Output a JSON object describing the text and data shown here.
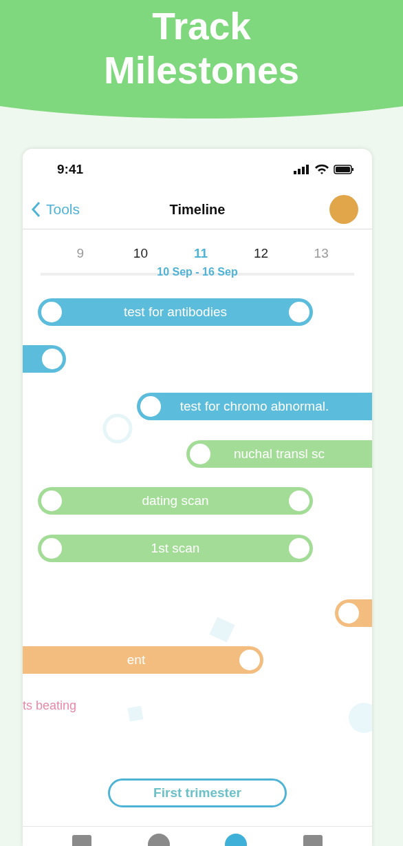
{
  "banner": {
    "title": "Track Milestones"
  },
  "status_bar": {
    "time": "9:41"
  },
  "nav": {
    "back": "Tools",
    "title": "Timeline"
  },
  "days": [
    {
      "label": "9",
      "selected": false,
      "emphasis": false
    },
    {
      "label": "10",
      "selected": false,
      "emphasis": true
    },
    {
      "label": "11",
      "selected": true,
      "emphasis": true
    },
    {
      "label": "12",
      "selected": false,
      "emphasis": true
    },
    {
      "label": "13",
      "selected": false,
      "emphasis": false
    }
  ],
  "week": "10 Sep - 16 Sep",
  "milestones": [
    {
      "kind": "bar",
      "label": "test for antibodies",
      "color": "#5bbcdb",
      "start_handle": true,
      "end_handle": true
    },
    {
      "kind": "bar",
      "color": "#5bbcdb",
      "start_handle": false,
      "end_handle": true
    },
    {
      "kind": "bar",
      "label": "test for chromo abnormal.",
      "color": "#5bbcdb",
      "start_handle": true,
      "end_handle": false
    },
    {
      "kind": "bar",
      "label": "nuchal transl sc",
      "color": "#a3dc96",
      "start_handle": true,
      "end_handle": false
    },
    {
      "kind": "bar",
      "label": "dating scan",
      "color": "#a3dc96",
      "start_handle": true,
      "end_handle": true
    },
    {
      "kind": "bar",
      "label": "1st scan",
      "color": "#a3dc96",
      "start_handle": true,
      "end_handle": true
    },
    {
      "kind": "bar",
      "color": "#f2bd7e",
      "start_handle": true,
      "end_handle": false
    },
    {
      "kind": "bar",
      "label": "ent",
      "color": "#f2bd7e",
      "start_handle": false,
      "end_handle": true
    },
    {
      "kind": "event",
      "label": "ts beating",
      "color": "#e889a6"
    }
  ],
  "trimester_button": "First trimester",
  "tab_bar": [
    {
      "selected": false
    },
    {
      "selected": false
    },
    {
      "selected": true
    },
    {
      "selected": false
    }
  ]
}
